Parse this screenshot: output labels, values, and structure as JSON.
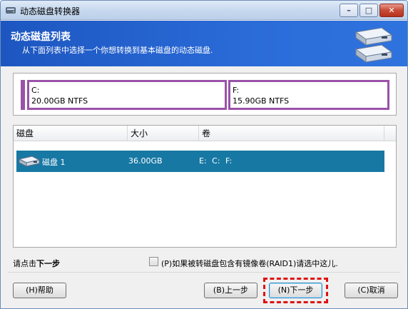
{
  "window": {
    "title": "动态磁盘转换器",
    "controls": {
      "minimize": "–",
      "maximize": "□",
      "close": "✕"
    }
  },
  "header": {
    "title": "动态磁盘列表",
    "subtitle": "从下面列表中选择一个你想转换到基本磁盘的动态磁盘."
  },
  "partitions": [
    {
      "letter": "C:",
      "info": "20.00GB NTFS"
    },
    {
      "letter": "F:",
      "info": "15.90GB NTFS"
    }
  ],
  "disk_list": {
    "columns": {
      "disk": "磁盘",
      "size": "大小",
      "volume": "卷"
    },
    "rows": [
      {
        "name": "磁盘 1",
        "size": "36.00GB",
        "volumes": "E:  C:  F:"
      }
    ]
  },
  "hint": {
    "prefix": "请点击",
    "bold": "下一步"
  },
  "raid_option": {
    "label": "(P)如果被转磁盘包含有镜像卷(RAID1)请选中这儿."
  },
  "buttons": {
    "help": "(H)帮助",
    "back": "(B)上一步",
    "next": "(N)下一步",
    "cancel": "(C)取消"
  },
  "colors": {
    "header_blue": "#2a6bd8",
    "partition_border": "#9a52a8",
    "selected_row": "#1778a4",
    "highlight_red": "#e01010"
  },
  "icons": {
    "app": "disk-icon",
    "header": "disk-stack-icon",
    "row": "hard-disk-icon"
  }
}
